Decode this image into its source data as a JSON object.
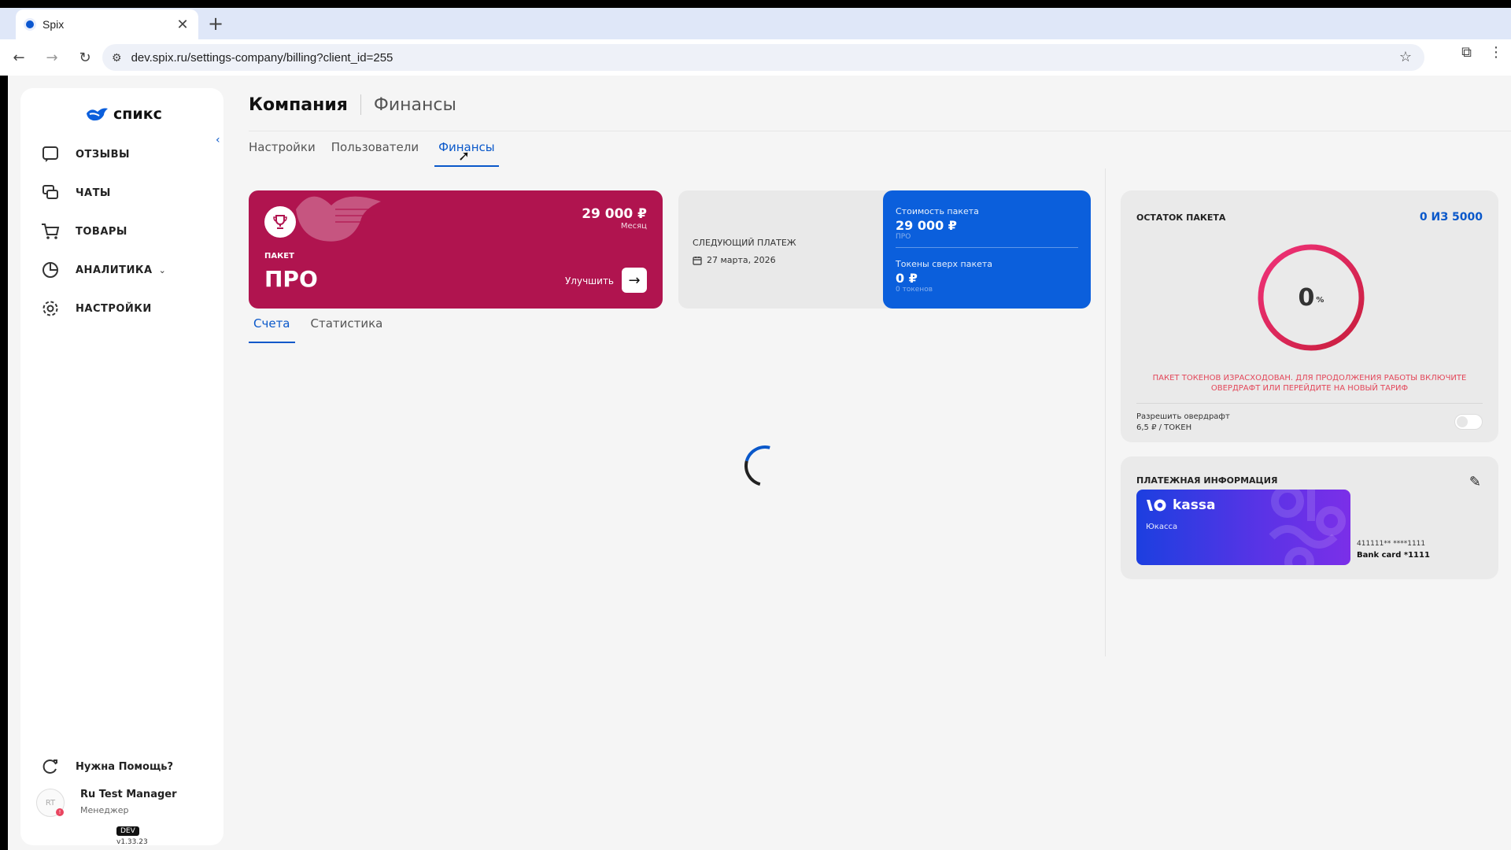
{
  "browser": {
    "tab_title": "Spix",
    "url": "dev.spix.ru/settings-company/billing?client_id=255"
  },
  "sidebar": {
    "logo_text": "спикс",
    "items": [
      {
        "label": "ОТЗЫВЫ",
        "icon": "reviews-icon"
      },
      {
        "label": "ЧАТЫ",
        "icon": "chat-icon"
      },
      {
        "label": "ТОВАРЫ",
        "icon": "cart-icon"
      },
      {
        "label": "АНАЛИТИКА",
        "icon": "analytics-icon"
      },
      {
        "label": "НАСТРОЙКИ",
        "icon": "gear-icon"
      }
    ],
    "help_label": "Нужна Помощь?",
    "user_name": "Ru Test Manager",
    "user_role": "Менеджер",
    "avatar_initials": "RT",
    "env_badge": "DEV",
    "version": "v1.33.23"
  },
  "header": {
    "title": "Компания",
    "subtitle": "Финансы",
    "tabs": [
      "Настройки",
      "Пользователи",
      "Финансы"
    ],
    "active_tab": "Финансы"
  },
  "plan": {
    "price": "29 000 ₽",
    "period": "Месяц",
    "label": "ПАКЕТ",
    "name": "ПРО",
    "upgrade_label": "Улучшить",
    "color": "#b0144f"
  },
  "payment": {
    "next_label": "СЛЕДУЮЩИЙ ПЛАТЕЖ",
    "next_date": "27 марта, 2026",
    "cost_label": "Стоимость пакета",
    "cost_value": "29 000 ₽",
    "cost_sub": "ПРО",
    "over_label": "Токены сверх пакета",
    "over_value": "0 ₽",
    "over_sub": "0 токенов",
    "color": "#0b5fdc"
  },
  "sub_tabs": [
    "Счета",
    "Статистика"
  ],
  "active_sub_tab": "Счета",
  "remaining": {
    "title": "ОСТАТОК ПАКЕТА",
    "count": "0 ИЗ  5000",
    "percent_value": "0",
    "percent_sign": "%",
    "warning": "ПАКЕТ ТОКЕНОВ ИЗРАСХОДОВАН. ДЛЯ ПРОДОЛЖЕНИЯ РАБОТЫ ВКЛЮЧИТЕ ОВЕРДРАФТ ИЛИ ПЕРЕЙДИТЕ НА НОВЫЙ ТАРИФ",
    "overdraft_label": "Разрешить овердрафт",
    "overdraft_price": "6,5 ₽ / ТОКЕН",
    "overdraft_enabled": false
  },
  "billing": {
    "title": "ПЛАТЕЖНАЯ ИНФОРМАЦИЯ",
    "provider": "kassa",
    "provider_sub": "Юкасса",
    "card_mask": "411111** ****1111",
    "card_name": "Bank card *1111"
  }
}
